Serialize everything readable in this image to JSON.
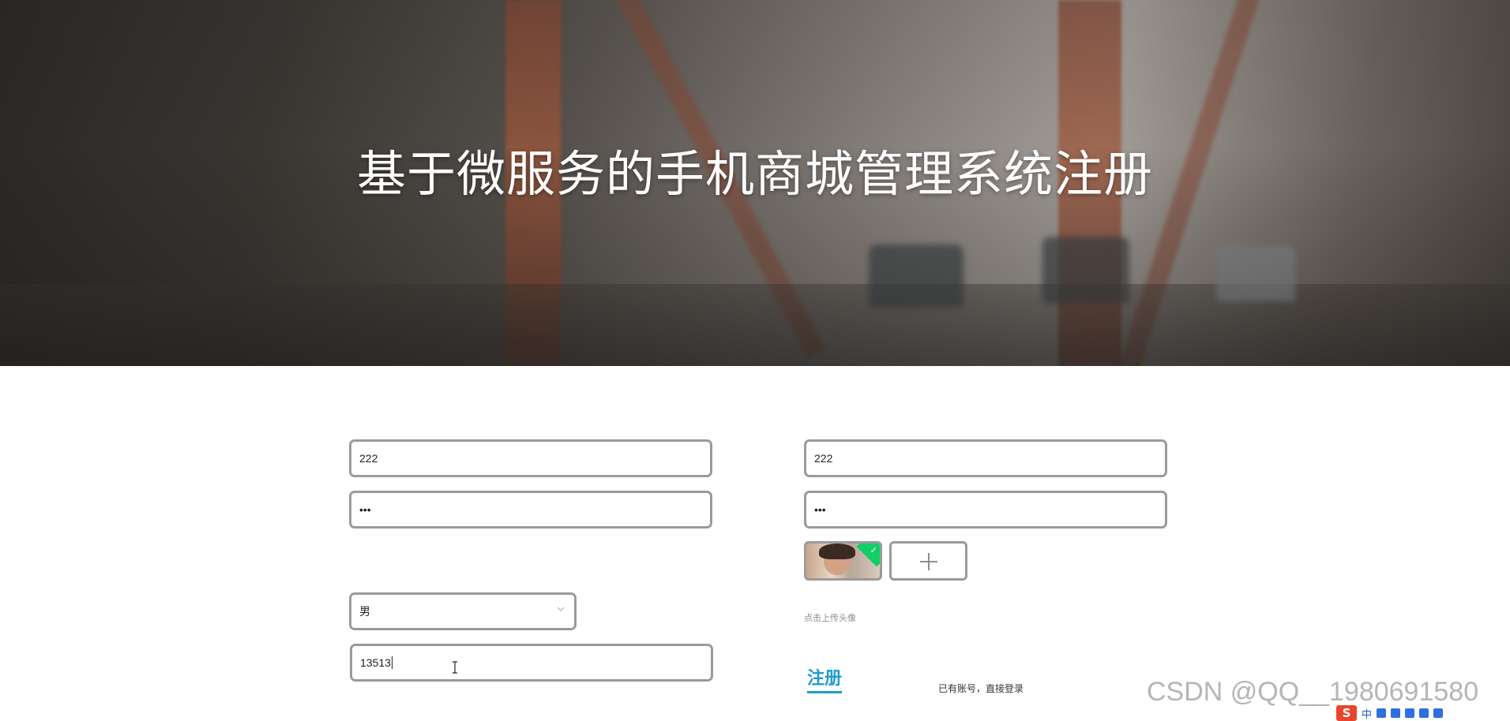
{
  "hero": {
    "title": "基于微服务的手机商城管理系统注册"
  },
  "form": {
    "left": {
      "username_value": "222",
      "password_value": "•••",
      "gender_selected": "男",
      "phone_value": "13513"
    },
    "right": {
      "field1_value": "222",
      "field2_value": "•••",
      "upload_tip": "点击上传头像",
      "upload_plus": "+",
      "uploaded_check": "✓"
    },
    "register_label": "注册",
    "login_link": "已有账号，直接登录"
  },
  "watermark": "CSDN @QQ__1980691580",
  "ime": {
    "logo": "S",
    "mode": "中"
  },
  "colors": {
    "accent": "#1e9bd0",
    "upload_success": "#13ce66",
    "field_border": "#9a9a9a"
  }
}
